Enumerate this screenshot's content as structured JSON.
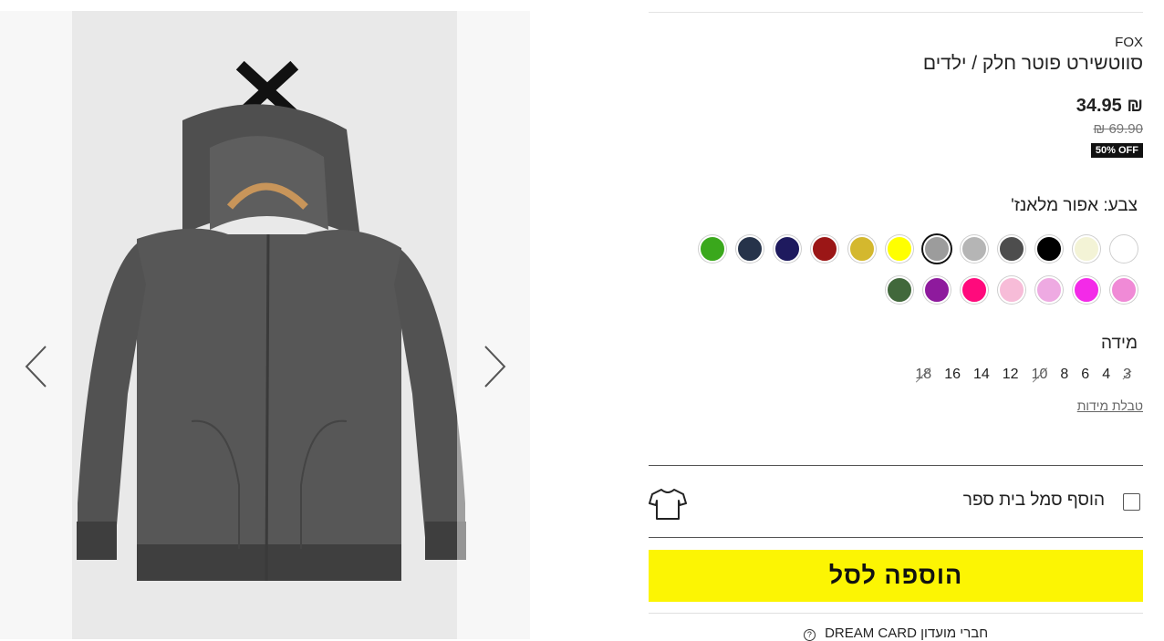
{
  "product": {
    "brand": "FOX",
    "title": "סווטשירט פוטר חלק / ילדים",
    "price": "34.95 ₪",
    "old_price": "₪ 69.90",
    "discount_badge": "50% OFF"
  },
  "gallery": {
    "prev_icon": "chevron-left-icon",
    "next_icon": "chevron-right-icon",
    "image_subject": "hoodie"
  },
  "color": {
    "label": "צבע:",
    "selected": "אפור מלאנז'",
    "swatches": [
      {
        "name": "white",
        "hex": "#ffffff",
        "selected": false
      },
      {
        "name": "cream",
        "hex": "#f3f3d6",
        "selected": false
      },
      {
        "name": "black",
        "hex": "#000000",
        "selected": false
      },
      {
        "name": "dark-grey",
        "hex": "#4d4d4d",
        "selected": false
      },
      {
        "name": "light-grey",
        "hex": "#b5b5b5",
        "selected": false
      },
      {
        "name": "grey-melange",
        "hex": "#9c9c9c",
        "selected": true
      },
      {
        "name": "yellow",
        "hex": "#ffff00",
        "selected": false
      },
      {
        "name": "mustard",
        "hex": "#d4b82e",
        "selected": false
      },
      {
        "name": "dark-red",
        "hex": "#9b1616",
        "selected": false
      },
      {
        "name": "navy",
        "hex": "#1e1a5e",
        "selected": false
      },
      {
        "name": "dark-slate",
        "hex": "#26334a",
        "selected": false
      },
      {
        "name": "green",
        "hex": "#3aa81c",
        "selected": false
      },
      {
        "name": "pink",
        "hex": "#f08ad6",
        "selected": false
      },
      {
        "name": "magenta",
        "hex": "#f32ae8",
        "selected": false
      },
      {
        "name": "lavender-pink",
        "hex": "#eeaae2",
        "selected": false
      },
      {
        "name": "baby-pink",
        "hex": "#f7bcd8",
        "selected": false
      },
      {
        "name": "hot-pink",
        "hex": "#ff0a7c",
        "selected": false
      },
      {
        "name": "purple",
        "hex": "#8e1a9d",
        "selected": false
      },
      {
        "name": "forest-green",
        "hex": "#41683b",
        "selected": false
      }
    ]
  },
  "size": {
    "label": "מידה",
    "options": [
      {
        "label": "3",
        "available": false
      },
      {
        "label": "4",
        "available": true
      },
      {
        "label": "6",
        "available": true
      },
      {
        "label": "8",
        "available": true
      },
      {
        "label": "10",
        "available": false
      },
      {
        "label": "12",
        "available": true
      },
      {
        "label": "14",
        "available": true
      },
      {
        "label": "16",
        "available": true
      },
      {
        "label": "18",
        "available": false
      }
    ],
    "chart_link": "טבלת מידות"
  },
  "addon": {
    "label": "הוסף סמל בית ספר",
    "icon": "tshirt-icon",
    "checked": false
  },
  "cart": {
    "button_label": "הוספה לסל"
  },
  "club": {
    "text": "חברי מועדון DREAM CARD",
    "help_glyph": "?"
  }
}
